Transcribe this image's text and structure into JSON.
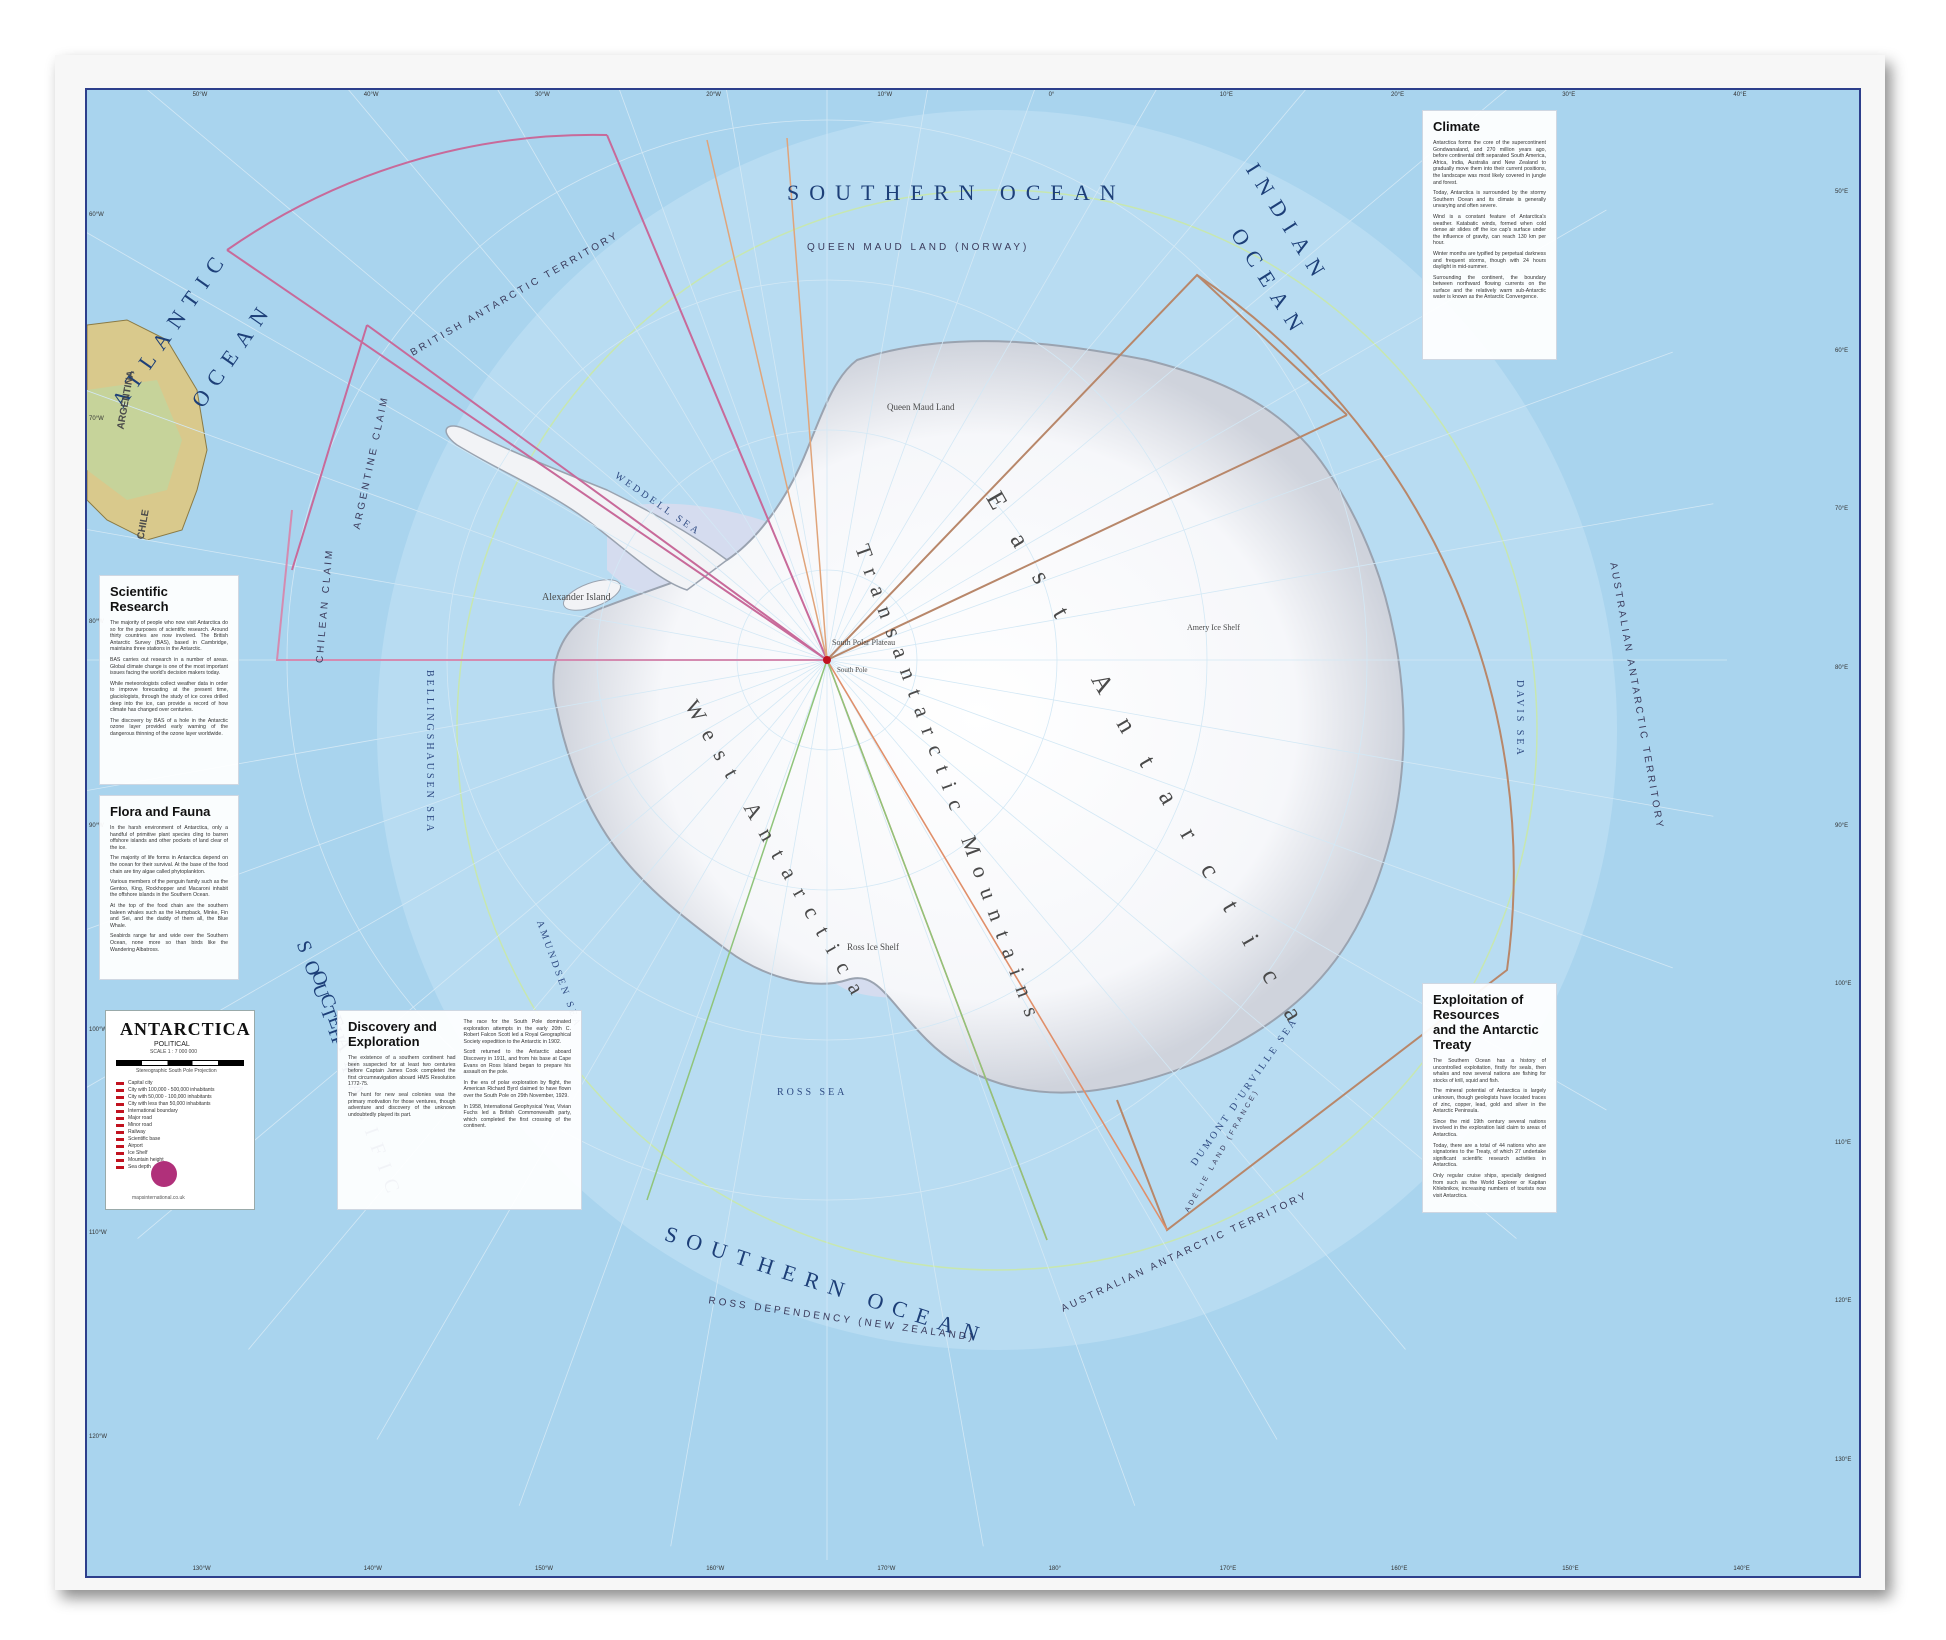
{
  "map": {
    "title": "ANTARCTICA",
    "subtitle": "POLITICAL",
    "scale": "SCALE 1 : 7 000 000",
    "projection": "Stereographic South Pole Projection",
    "publisher": "mapsinternational.co.uk"
  },
  "oceans": {
    "southern_top": "SOUTHERN OCEAN",
    "southern_bottom": "SOUTHERN OCEAN",
    "indian_1": "INDIAN",
    "indian_2": "OCEAN",
    "atlantic_1": "ATLANTIC",
    "atlantic_2": "OCEAN",
    "pacific_1": "SOUTH PACIFIC",
    "pacific_2": "OCEAN"
  },
  "seas": {
    "weddell": "WEDDELL SEA",
    "ross": "ROSS SEA",
    "bellingshausen": "BELLINGSHAUSEN SEA",
    "amundsen": "AMUNDSEN SEA",
    "davis": "DAVIS SEA",
    "dumont": "DUMONT D'URVILLE SEA"
  },
  "territories": {
    "british": "BRITISH ANTARCTIC TERRITORY",
    "argentine": "ARGENTINE CLAIM",
    "chilean": "CHILEAN CLAIM",
    "queen_maud": "QUEEN MAUD LAND (NORWAY)",
    "australian_right": "AUSTRALIAN ANTARCTIC TERRITORY",
    "australian_bottom": "AUSTRALIAN ANTARCTIC TERRITORY",
    "ross_dependency": "ROSS DEPENDENCY (NEW ZEALAND)",
    "adelie": "ADÉLIE LAND (FRANCE)"
  },
  "regions": {
    "east_antarctica": "East Antarctica",
    "west_antarctica": "West Antarctica",
    "transantarctic": "Transantarctic Mountains",
    "queen_maud_land": "Queen Maud Land",
    "alexander_island": "Alexander Island",
    "ross_ice_shelf": "Ross Ice Shelf",
    "amery_ice_shelf": "Amery Ice Shelf",
    "south_polar_plateau": "South Polar Plateau",
    "south_pole": "South Pole",
    "argentina": "ARGENTINA",
    "chile": "CHILE"
  },
  "panels": {
    "climate": {
      "heading": "Climate",
      "paragraphs": [
        "Antarctica forms the core of the supercontinent Gondwanaland, and 270 million years ago, before continental drift separated South America, Africa, India, Australia and New Zealand to gradually move them into their current positions, the landscape was most likely covered in jungle and forest.",
        "Today, Antarctica is surrounded by the stormy Southern Ocean and its climate is generally unvarying and often severe.",
        "Wind is a constant feature of Antarctica's weather. Katabatic winds, formed when cold dense air slides off the ice cap's surface under the influence of gravity, can reach 130 km per hour.",
        "Winter months are typified by perpetual darkness and frequent storms, though with 24 hours daylight in mid-summer.",
        "Surrounding the continent, the boundary between northward flowing currents on the surface and the relatively warm sub-Antarctic water is known as the Antarctic Convergence."
      ]
    },
    "scientific": {
      "heading": "Scientific Research",
      "paragraphs": [
        "The majority of people who now visit Antarctica do so for the purposes of scientific research. Around thirty countries are now involved. The British Antarctic Survey (BAS), based in Cambridge, maintains three stations in the Antarctic.",
        "BAS carries out research in a number of areas. Global climate change is one of the most important issues facing the world's decision makers today.",
        "While meteorologists collect weather data in order to improve forecasting at the present time, glaciologists, through the study of ice cores drilled deep into the ice, can provide a record of how climate has changed over centuries.",
        "The discovery by BAS of a hole in the Antarctic ozone layer provided early warning of the dangerous thinning of the ozone layer worldwide."
      ]
    },
    "flora": {
      "heading": "Flora and Fauna",
      "paragraphs": [
        "In the harsh environment of Antarctica, only a handful of primitive plant species cling to barren offshore islands and other pockets of land clear of the ice.",
        "The majority of life forms in Antarctica depend on the ocean for their survival. At the base of the food chain are tiny algae called phytoplankton.",
        "Various members of the penguin family such as the Gentoo, King, Rockhopper and Macaroni inhabit the offshore islands in the Southern Ocean.",
        "At the top of the food chain are the southern baleen whales such as the Humpback, Minke, Fin and Sei, and the daddy of them all, the Blue Whale.",
        "Seabirds range far and wide over the Southern Ocean, none more so than birds like the Wandering Albatross."
      ]
    },
    "discovery": {
      "heading": "Discovery and Exploration",
      "paragraphs": [
        "The existence of a southern continent had been suspected for at least two centuries before Captain James Cook completed the first circumnavigation aboard HMS Resolution 1772-75.",
        "The hunt for new seal colonies was the primary motivation for those ventures, though adventure and discovery of the unknown undoubtedly played its part.",
        "The race for the South Pole dominated exploration attempts in the early 20th C. Robert Falcon Scott led a Royal Geographical Society expedition to the Antarctic in 1902.",
        "Scott returned to the Antarctic aboard Discovery in 1911, and from his base at Cape Evans on Ross Island began to prepare his assault on the pole.",
        "In the era of polar exploration by flight, the American Richard Byrd claimed to have flown over the South Pole on 29th November, 1929.",
        "In 1958, International Geophysical Year, Vivian Fuchs led a British Commonwealth party, which completed the first crossing of the continent."
      ]
    },
    "exploitation": {
      "heading_1": "Exploitation of Resources",
      "heading_2": "and the Antarctic Treaty",
      "paragraphs": [
        "The Southern Ocean has a history of uncontrolled exploitation, firstly for seals, then whales and now several nations are fishing for stocks of krill, squid and fish.",
        "The mineral potential of Antarctica is largely unknown, though geologists have located traces of zinc, copper, lead, gold and silver in the Antarctic Peninsula.",
        "Since the mid 19th century several nations involved in the exploration laid claim to areas of Antarctica.",
        "Today, there are a total of 44 nations who are signatories to the Treaty, of which 27 undertake significant scientific research activities in Antarctica.",
        "Only regular cruise ships, specially designed from such as the World Explorer or Kapitan Khlebnikov, increasing numbers of tourists now visit Antarctica."
      ]
    }
  },
  "legend": {
    "items": [
      "Capital city",
      "City with 100,000 - 500,000 inhabitants",
      "City with 50,000 - 100,000 inhabitants",
      "City with less than 50,000 inhabitants",
      "International boundary",
      "Major road",
      "Minor road",
      "Railway",
      "Scientific base",
      "Airport",
      "Ice Shelf",
      "Mountain height",
      "Sea depth"
    ],
    "scale_ticks": [
      "0",
      "100",
      "200",
      "300",
      "400",
      "500 km"
    ],
    "scale_ticks_miles": [
      "0",
      "100",
      "200",
      "300 miles"
    ]
  },
  "graticule": {
    "top": [
      "50°W",
      "40°W",
      "30°W",
      "20°W",
      "10°W",
      "0°",
      "10°E",
      "20°E",
      "30°E",
      "40°E"
    ],
    "bottom": [
      "130°W",
      "140°W",
      "150°W",
      "160°W",
      "170°W",
      "180°",
      "170°E",
      "160°E",
      "150°E",
      "140°E"
    ],
    "left": [
      "60°W",
      "70°W",
      "80°W",
      "90°W",
      "100°W",
      "110°W",
      "120°W"
    ],
    "right": [
      "50°E",
      "60°E",
      "70°E",
      "80°E",
      "90°E",
      "100°E",
      "110°E",
      "120°E",
      "130°E"
    ]
  },
  "colors": {
    "ocean": "#a9d4ee",
    "ice": "#ffffff",
    "territory_british": "#c86a9a",
    "territory_australian": "#b8876a",
    "frame": "#2d3f8c"
  }
}
